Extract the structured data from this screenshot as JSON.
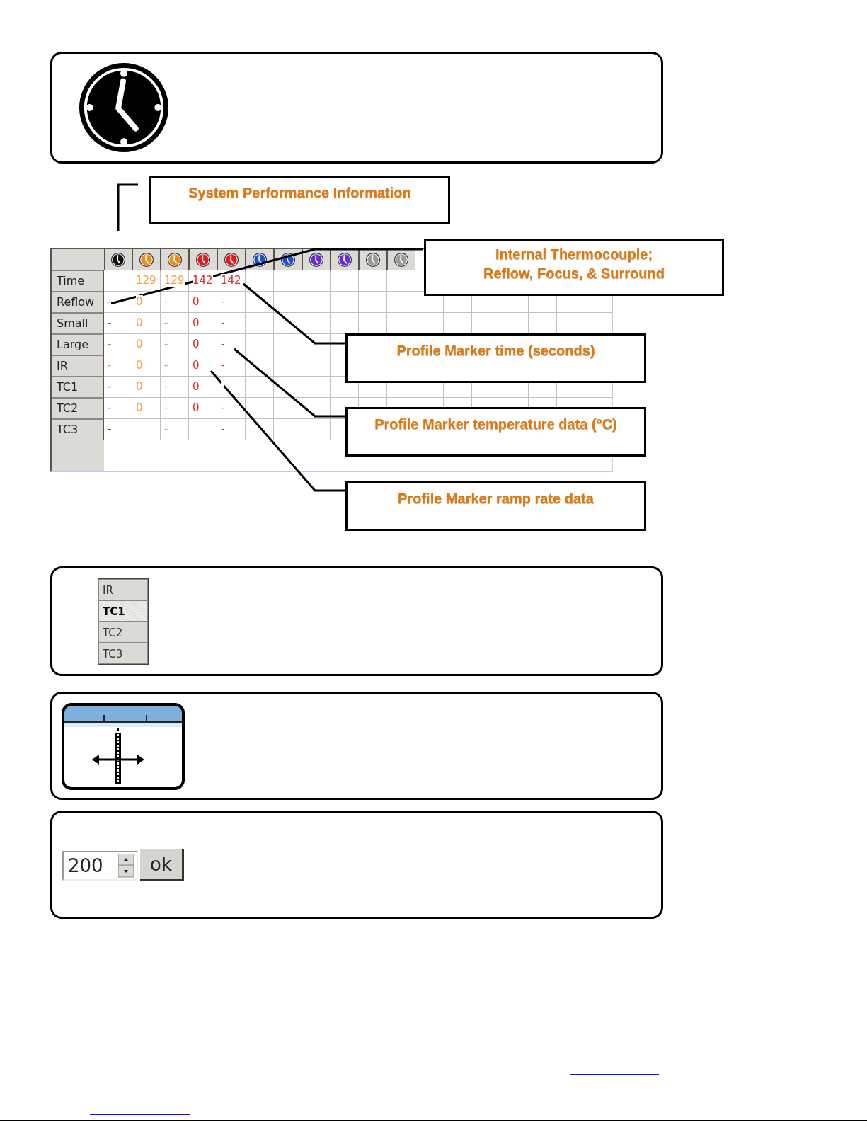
{
  "system_callout": {
    "text": "System Performance Information"
  },
  "thermocouple_callout": {
    "lines": [
      "Internal Thermocouple;",
      "Reflow, Focus, & Surround"
    ]
  },
  "marker_callouts": [
    {
      "text": "Profile Marker time (seconds)"
    },
    {
      "text": "Profile Marker temperature data (°C)"
    },
    {
      "text": "Profile Marker ramp rate data"
    }
  ],
  "table": {
    "columns": [
      {
        "color": "#111111"
      },
      {
        "color": "#f28a12"
      },
      {
        "color": "#f28a12"
      },
      {
        "color": "#e81818"
      },
      {
        "color": "#e81818"
      },
      {
        "color": "#1a4fe0"
      },
      {
        "color": "#1a4fe0"
      },
      {
        "color": "#6a2ad8"
      },
      {
        "color": "#6a2ad8"
      },
      {
        "color": "#9a9a9a"
      },
      {
        "color": "#9a9a9a"
      }
    ],
    "rows": [
      {
        "label": "Time",
        "cells": [
          null,
          {
            "text": "129",
            "color": "#f0a040"
          },
          {
            "text": "129",
            "color": "#f0a040"
          },
          {
            "text": "142",
            "color": "#d03030"
          },
          {
            "text": "142",
            "color": "#d03030"
          }
        ]
      },
      {
        "label": "Reflow",
        "cells": [
          {
            "text": "-",
            "color": "#e06060"
          },
          {
            "text": "0",
            "color": "#f0a040"
          },
          {
            "text": "-",
            "color": "#f0a040"
          },
          {
            "text": "0",
            "color": "#d03030"
          },
          {
            "text": "-",
            "color": "#d03030"
          }
        ]
      },
      {
        "label": "Small",
        "cells": [
          {
            "text": "-",
            "color": "#4060d0"
          },
          {
            "text": "0",
            "color": "#f0a040"
          },
          {
            "text": "-",
            "color": "#f0a040"
          },
          {
            "text": "0",
            "color": "#d03030"
          },
          {
            "text": "-",
            "color": "#d03030"
          }
        ]
      },
      {
        "label": "Large",
        "cells": [
          {
            "text": "-",
            "color": "#50b050"
          },
          {
            "text": "0",
            "color": "#f0a040"
          },
          {
            "text": "-",
            "color": "#f0a040"
          },
          {
            "text": "0",
            "color": "#d03030"
          },
          {
            "text": "-",
            "color": "#d03030"
          }
        ]
      },
      {
        "label": "IR",
        "cells": [
          {
            "text": "-",
            "color": "#f0a040"
          },
          {
            "text": "0",
            "color": "#f0a040"
          },
          {
            "text": "-",
            "color": "#f0a040"
          },
          {
            "text": "0",
            "color": "#d03030"
          },
          {
            "text": "-",
            "color": "#d03030"
          }
        ]
      },
      {
        "label": "TC1",
        "cells": [
          {
            "text": "-",
            "color": "#111111"
          },
          {
            "text": "0",
            "color": "#f0a040"
          },
          {
            "text": "-",
            "color": "#f0a040"
          },
          {
            "text": "0",
            "color": "#d03030"
          },
          {
            "text": "-",
            "color": "#d03030"
          }
        ]
      },
      {
        "label": "TC2",
        "cells": [
          {
            "text": "-",
            "color": "#202060"
          },
          {
            "text": "0",
            "color": "#f0a040"
          },
          {
            "text": "-",
            "color": "#f0a040"
          },
          {
            "text": "0",
            "color": "#d03030"
          },
          {
            "text": "-",
            "color": "#d03030"
          }
        ]
      },
      {
        "label": "TC3",
        "cells": [
          {
            "text": "-",
            "color": "#206020"
          },
          null,
          {
            "text": "-",
            "color": "#f0a040"
          },
          null,
          {
            "text": "-",
            "color": "#d03030"
          }
        ]
      }
    ]
  },
  "channel_list": [
    {
      "label": "IR",
      "selected": false
    },
    {
      "label": "TC1",
      "selected": true
    },
    {
      "label": "TC2",
      "selected": false
    },
    {
      "label": "TC3",
      "selected": false
    }
  ],
  "spin": {
    "value": "200",
    "button": "ok"
  }
}
